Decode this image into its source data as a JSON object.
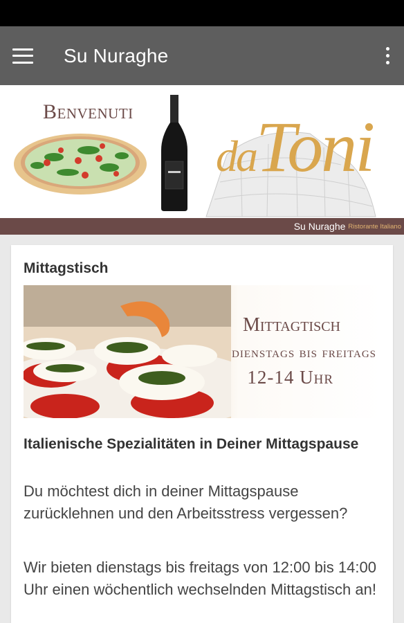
{
  "app_bar": {
    "title": "Su Nuraghe",
    "menu_icon": "hamburger-menu-icon",
    "overflow_icon": "more-vert-icon"
  },
  "banner": {
    "welcome": "Benvenuti",
    "logo_small": "da",
    "logo_big": "Toni",
    "footer_name": "Su Nuraghe",
    "footer_sub": "Ristorante Italiano"
  },
  "card": {
    "title": "Mittagstisch",
    "image_overlay": {
      "line1": "Mittagtisch",
      "line2": "dienstags bis freitags",
      "line3": "12-14 Uhr"
    },
    "heading": "Italienische Spezialitäten in Deiner Mittagspause",
    "paragraph1": "Du möchtest dich in deiner Mittagspause zurücklehnen und den Arbeitsstress vergessen?",
    "paragraph2": "Wir bieten dienstags bis freitags von 12:00 bis 14:00 Uhr einen wöchentlich wechselnden Mittagstisch an!"
  },
  "colors": {
    "app_bar": "#5e5e5e",
    "status_bar": "#000000",
    "brand_brown": "#6b4a48",
    "logo_gold": "#d9a64e"
  }
}
